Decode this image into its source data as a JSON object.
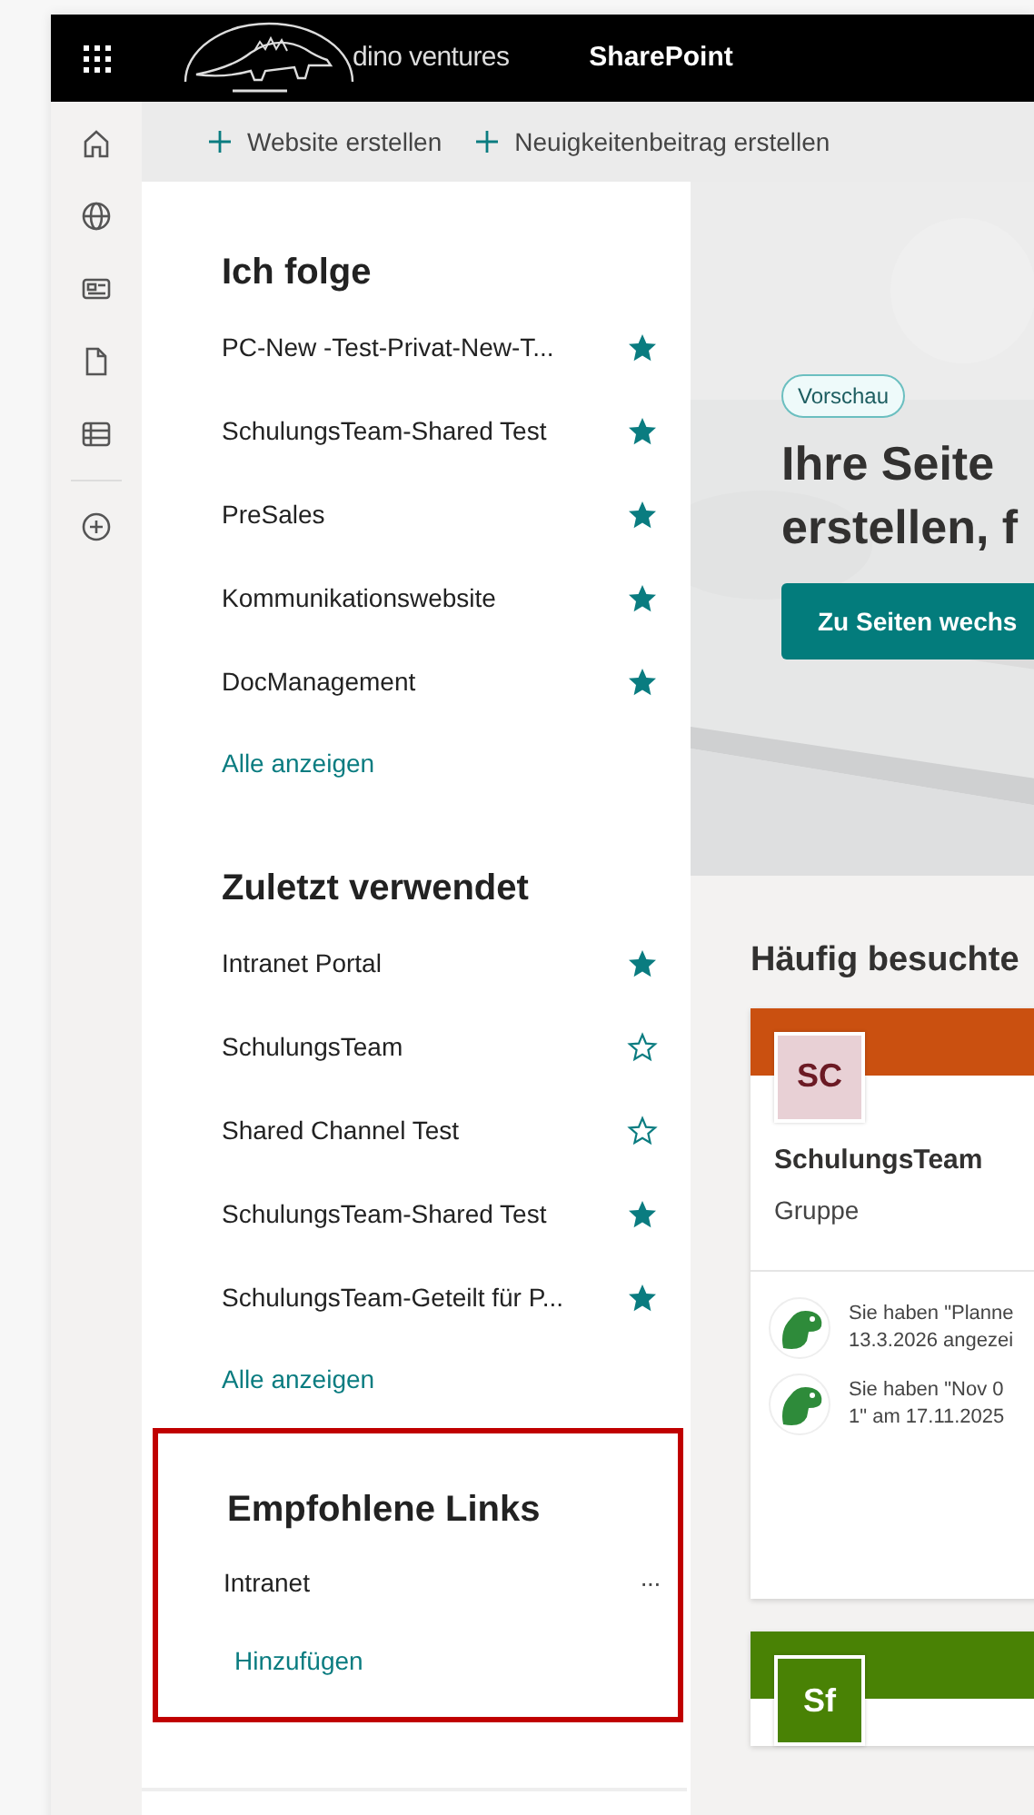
{
  "app_bar": {
    "logo_text": "dino ventures",
    "title": "SharePoint"
  },
  "commands": [
    {
      "label": "Website erstellen"
    },
    {
      "label": "Neuigkeitenbeitrag erstellen"
    }
  ],
  "sections": [
    {
      "title": "Ich folge",
      "show_all": "Alle anzeigen",
      "items": [
        {
          "label": "PC-New -Test-Privat-New-T...",
          "starred": true
        },
        {
          "label": "SchulungsTeam-Shared Test",
          "starred": true
        },
        {
          "label": "PreSales",
          "starred": true
        },
        {
          "label": "Kommunikationswebsite",
          "starred": true
        },
        {
          "label": "DocManagement",
          "starred": true
        }
      ]
    },
    {
      "title": "Zuletzt verwendet",
      "show_all": "Alle anzeigen",
      "items": [
        {
          "label": "Intranet Portal",
          "starred": true
        },
        {
          "label": "SchulungsTeam",
          "starred": false
        },
        {
          "label": "Shared Channel Test",
          "starred": false
        },
        {
          "label": "SchulungsTeam-Shared Test",
          "starred": true
        },
        {
          "label": "SchulungsTeam-Geteilt für P...",
          "starred": true
        }
      ]
    }
  ],
  "recommended": {
    "title": "Empfohlene Links",
    "highlighted": true,
    "add": "Hinzufügen",
    "items": [
      {
        "label": "Intranet",
        "more": "···"
      }
    ]
  },
  "hero": {
    "badge": "Vorschau",
    "heading_lines": [
      "Ihre Seite",
      "erstellen, f"
    ],
    "button": "Zu Seiten wechs"
  },
  "frequent": {
    "title": "Häufig besuchte",
    "cards": [
      {
        "color": "#ca5010",
        "tile": {
          "initials": "SC",
          "color": "#e8d0d5"
        },
        "name": "SchulungsTeam",
        "type": "Gruppe",
        "activities": [
          {
            "text": "Sie haben \"Planne\n13.3.2026 angezei"
          },
          {
            "text": "Sie haben \"Nov 0\n1\" am 17.11.2025"
          }
        ]
      },
      {
        "color": "#498205",
        "tile": {
          "initials": "Sf",
          "color": "#498205"
        }
      }
    ]
  }
}
